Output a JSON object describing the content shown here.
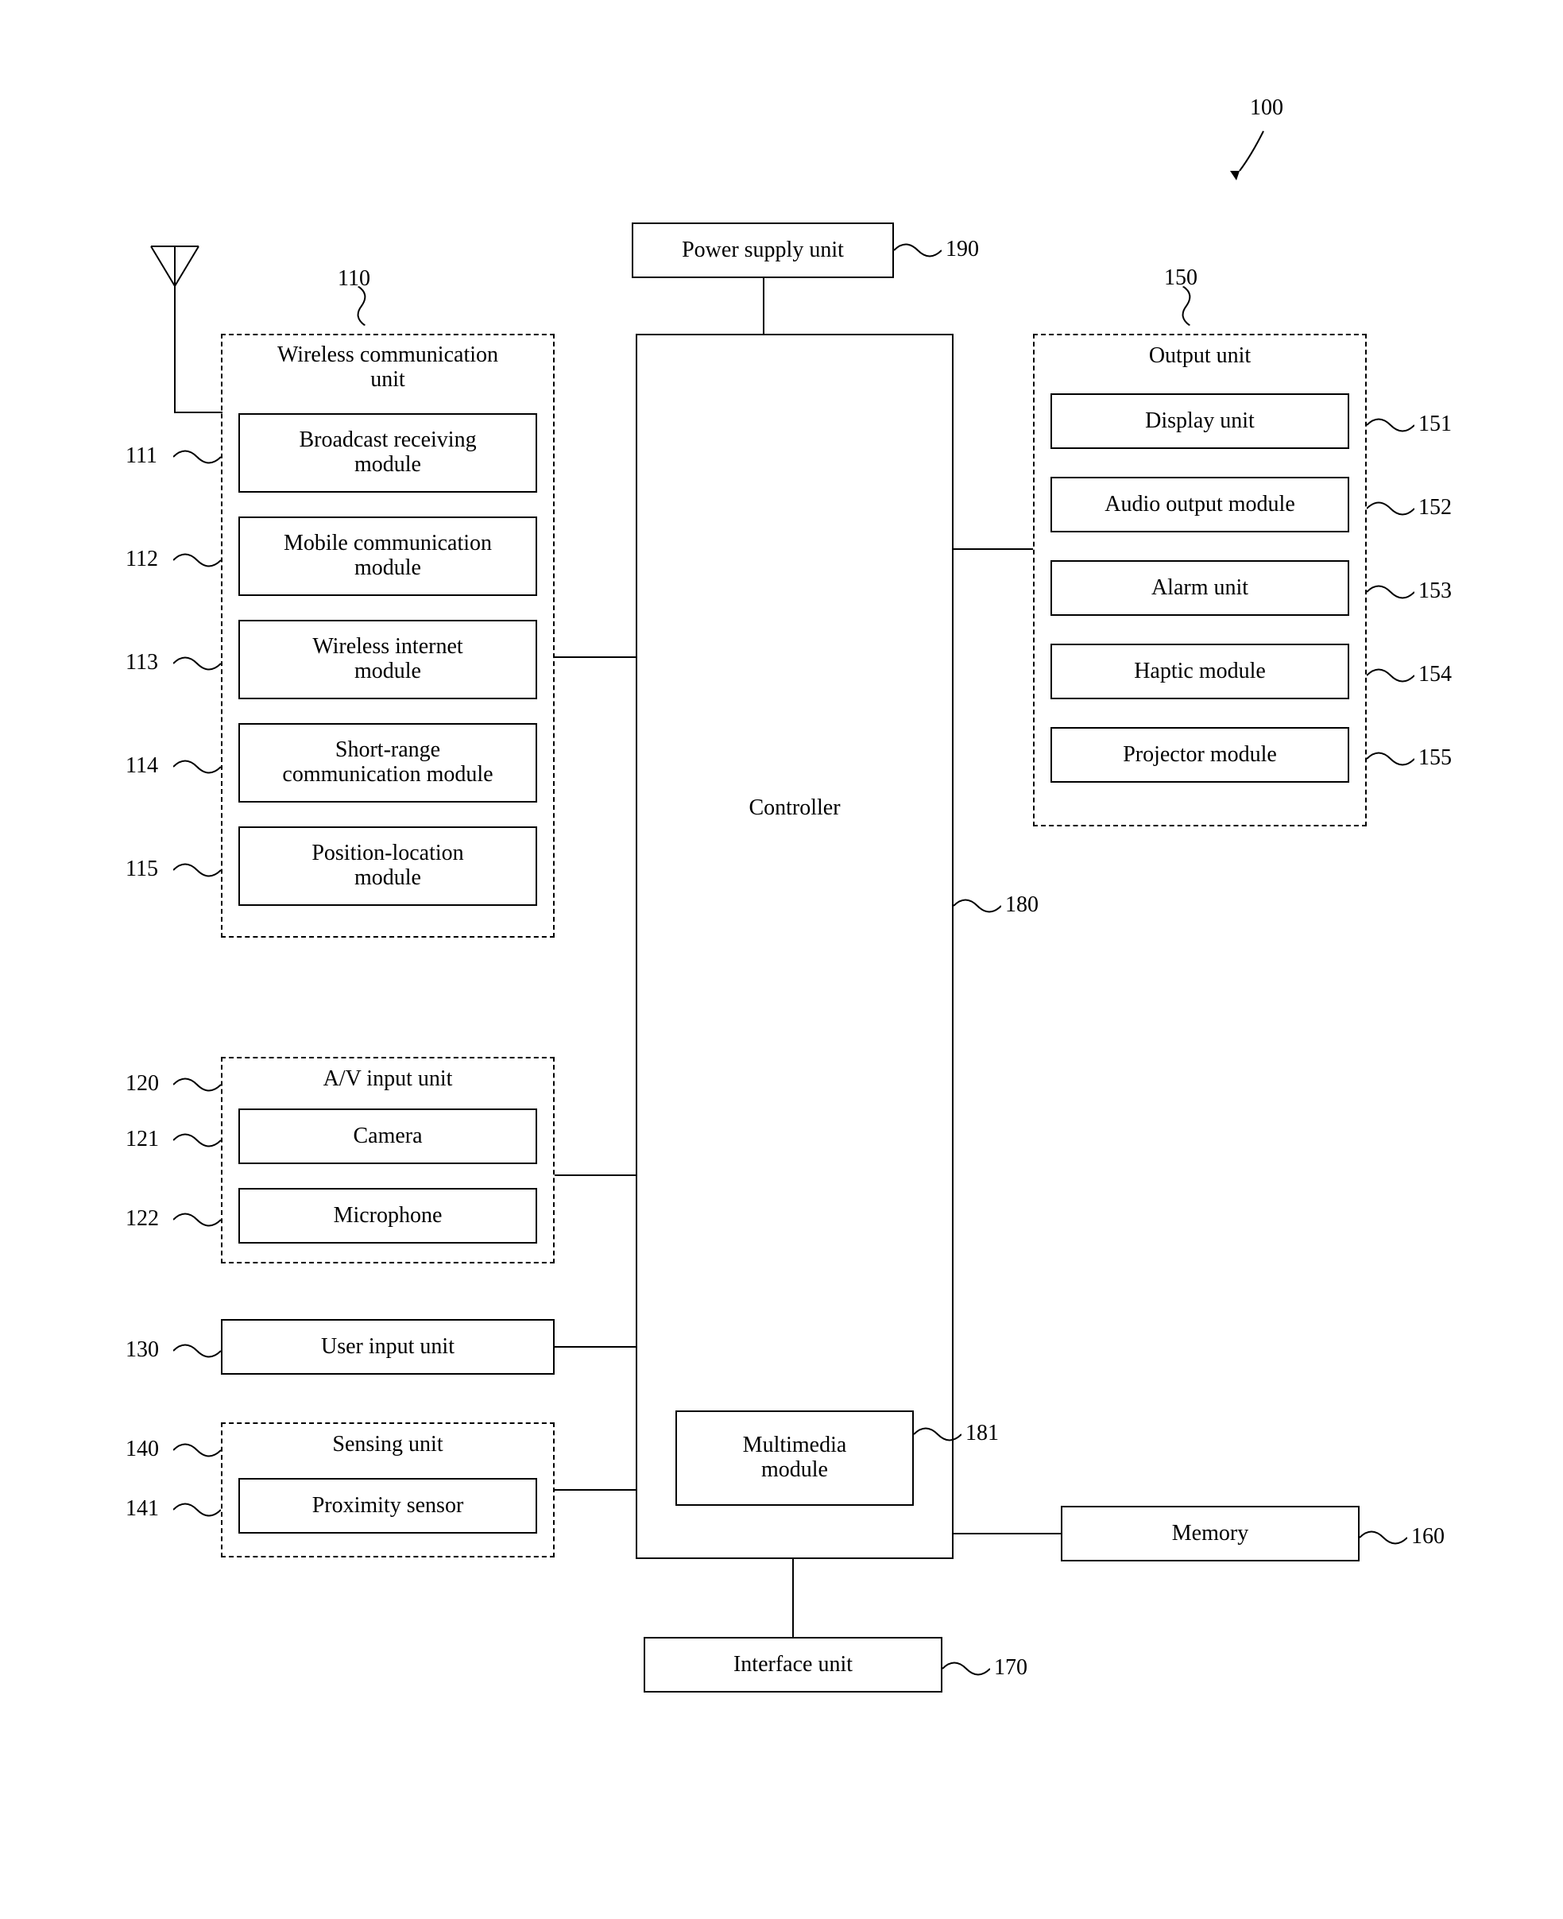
{
  "figure_ref": "100",
  "power_supply": {
    "label": "Power supply unit",
    "ref": "190"
  },
  "wireless_comm": {
    "title": "Wireless communication\nunit",
    "ref": "110",
    "items": [
      {
        "label": "Broadcast receiving\nmodule",
        "ref": "111"
      },
      {
        "label": "Mobile communication\nmodule",
        "ref": "112"
      },
      {
        "label": "Wireless internet\nmodule",
        "ref": "113"
      },
      {
        "label": "Short-range\ncommunication module",
        "ref": "114"
      },
      {
        "label": "Position-location\nmodule",
        "ref": "115"
      }
    ]
  },
  "av_input": {
    "title": "A/V input unit",
    "ref": "120",
    "items": [
      {
        "label": "Camera",
        "ref": "121"
      },
      {
        "label": "Microphone",
        "ref": "122"
      }
    ]
  },
  "user_input": {
    "label": "User input unit",
    "ref": "130"
  },
  "sensing": {
    "title": "Sensing unit",
    "ref": "140",
    "items": [
      {
        "label": "Proximity sensor",
        "ref": "141"
      }
    ]
  },
  "output": {
    "title": "Output unit",
    "ref": "150",
    "items": [
      {
        "label": "Display unit",
        "ref": "151"
      },
      {
        "label": "Audio output module",
        "ref": "152"
      },
      {
        "label": "Alarm unit",
        "ref": "153"
      },
      {
        "label": "Haptic module",
        "ref": "154"
      },
      {
        "label": "Projector module",
        "ref": "155"
      }
    ]
  },
  "controller": {
    "label": "Controller",
    "ref": "180"
  },
  "multimedia": {
    "label": "Multimedia\nmodule",
    "ref": "181"
  },
  "memory": {
    "label": "Memory",
    "ref": "160"
  },
  "interface": {
    "label": "Interface unit",
    "ref": "170"
  }
}
